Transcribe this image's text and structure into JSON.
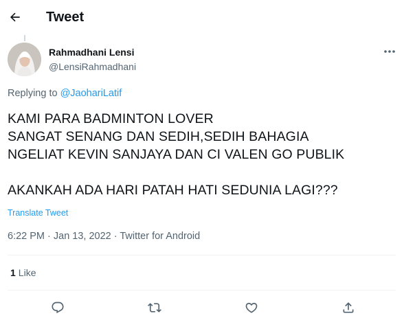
{
  "header": {
    "back_icon": "arrow-left-icon",
    "title": "Tweet"
  },
  "author": {
    "name": "Rahmadhani Lensi",
    "handle": "@LensiRahmadhani",
    "more_icon": "more-horizontal-icon"
  },
  "reply": {
    "prefix": "Replying to ",
    "handle": "@JaohariLatif"
  },
  "tweet": {
    "lines": [
      "KAMI PARA BADMINTON LOVER",
      "SANGAT SENANG DAN SEDIH,SEDIH BAHAGIA",
      "NGELIAT KEVIN SANJAYA DAN CI VALEN GO PUBLIK",
      "",
      "AKANKAH ADA HARI PATAH HATI SEDUNIA LAGI???"
    ],
    "translate_label": "Translate Tweet",
    "meta": "6:22 PM · Jan 13, 2022 · Twitter for Android"
  },
  "stats": {
    "likes_count": "1",
    "likes_label": "Like"
  },
  "actions": {
    "reply_icon": "reply-icon",
    "retweet_icon": "retweet-icon",
    "like_icon": "heart-icon",
    "share_icon": "share-icon"
  },
  "colors": {
    "accent": "#1d9bf0",
    "text": "#0f1419",
    "secondary": "#536471",
    "divider": "#eff3f4"
  }
}
